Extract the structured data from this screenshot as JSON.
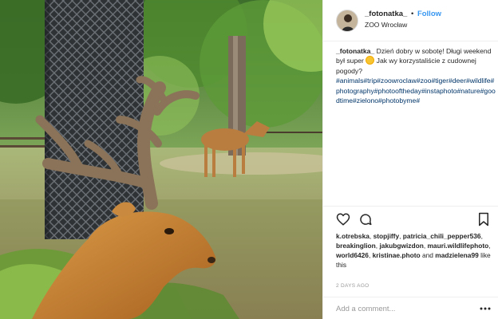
{
  "post": {
    "image_description": "",
    "username": "_fotonatka_",
    "separator": "•",
    "follow_label": "Follow",
    "location": "ZOO Wrocław"
  },
  "caption": {
    "user": "_fotonatka_",
    "text_before_emoji": "Dzień dobry w sobotę! Długi weekend był super",
    "emoji_icon": "sun-emoji-icon",
    "text_after_emoji": "Jak wy korzystaliście z cudownej pogody?",
    "hashtags": [
      "#animals",
      "#trip",
      "#zoowroclaw",
      "#zoo",
      "#tiger",
      "#deer",
      "#wildlife",
      "#photography",
      "#photooftheday",
      "#instaphoto",
      "#nature",
      "#goodtime",
      "#zielono",
      "#photobyme",
      "#"
    ]
  },
  "actions": {
    "like_icon": "heart-icon",
    "comment_icon": "comment-icon",
    "save_icon": "bookmark-icon"
  },
  "likes": {
    "users": [
      "k.otrebska",
      "stopjiffy",
      "patricia_chili_pepper536",
      "breakinglion",
      "jakubgwizdon",
      "mauri.wildlifephoto",
      "world6426",
      "kristinae.photo"
    ],
    "and_word": "and",
    "last_user": "madzielena99",
    "suffix": "like this"
  },
  "timestamp": "2 DAYS AGO",
  "comment": {
    "placeholder": "Add a comment...",
    "more_icon": "more-options-icon"
  },
  "colors": {
    "link_blue": "#3897f0",
    "hashtag_blue": "#003569",
    "muted_gray": "#999999",
    "border": "#efefef"
  }
}
